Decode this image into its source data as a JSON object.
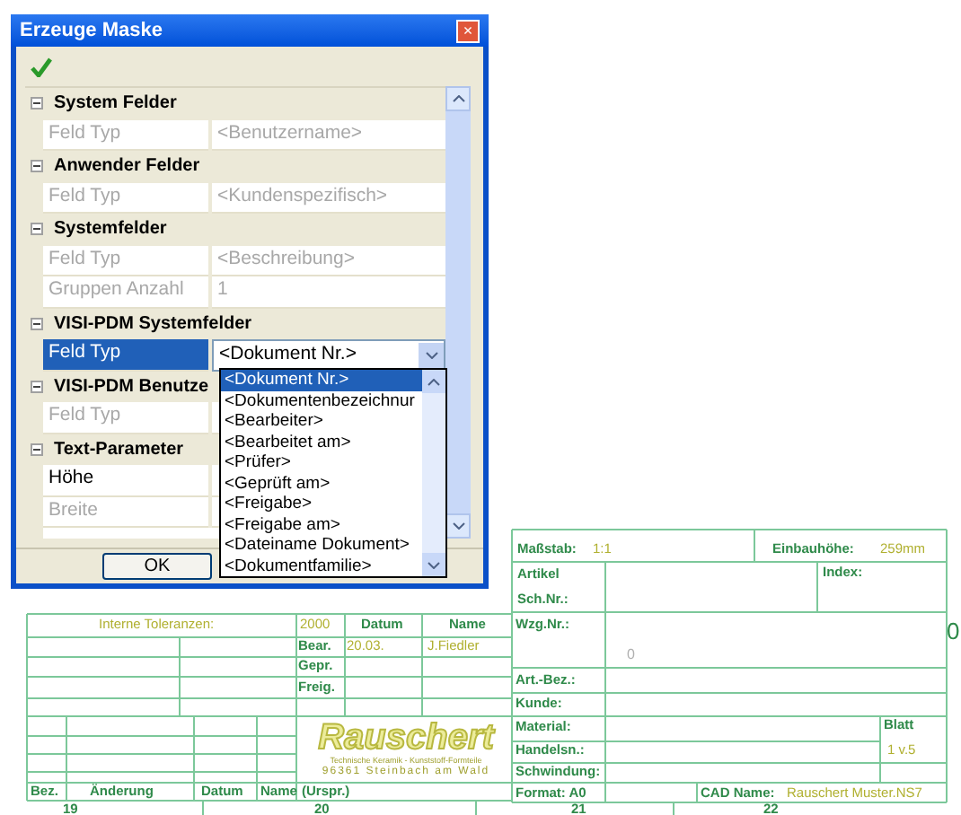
{
  "window": {
    "title": "Erzeuge Maske",
    "close": "×"
  },
  "sections": [
    {
      "title": "System Felder",
      "expanded": true,
      "rows": [
        {
          "label": "Feld Typ",
          "value": "<Benutzername>",
          "disabled": true,
          "selected": false
        }
      ]
    },
    {
      "title": "Anwender Felder",
      "expanded": true,
      "rows": [
        {
          "label": "Feld Typ",
          "value": "<Kundenspezifisch>",
          "disabled": true,
          "selected": false
        }
      ]
    },
    {
      "title": "Systemfelder",
      "expanded": true,
      "rows": [
        {
          "label": "Feld Typ",
          "value": "<Beschreibung>",
          "disabled": true,
          "selected": false
        },
        {
          "label": "Gruppen Anzahl",
          "value": "1",
          "disabled": true,
          "selected": false
        }
      ]
    },
    {
      "title": "VISI-PDM Systemfelder",
      "expanded": true,
      "rows": [
        {
          "label": "Feld Typ",
          "value": "<Dokument Nr.>",
          "disabled": false,
          "selected": true,
          "kind": "combo"
        }
      ]
    },
    {
      "title": "VISI-PDM Benutze",
      "expanded": true,
      "rows": [
        {
          "label": "Feld Typ",
          "disabled": true,
          "selected": false
        }
      ]
    },
    {
      "title": "Text-Parameter",
      "expanded": true,
      "rows": [
        {
          "label": "Höhe",
          "disabled": false,
          "selected": false
        },
        {
          "label": "Breite",
          "disabled": true,
          "selected": false
        }
      ]
    }
  ],
  "dropdown": {
    "items": [
      {
        "label": "<Dokument Nr.>",
        "selected": true
      },
      {
        "label": "<Dokumentenbezeichnur",
        "selected": false
      },
      {
        "label": "<Bearbeiter>",
        "selected": false
      },
      {
        "label": "<Bearbeitet am>",
        "selected": false
      },
      {
        "label": "<Prüfer>",
        "selected": false
      },
      {
        "label": "<Geprüft am>",
        "selected": false
      },
      {
        "label": "<Freigabe>",
        "selected": false
      },
      {
        "label": "<Freigabe am>",
        "selected": false
      },
      {
        "label": "<Dateiname Dokument>",
        "selected": false
      },
      {
        "label": "<Dokumentfamilie>",
        "selected": false
      }
    ]
  },
  "buttons": [
    {
      "label": "OK"
    }
  ],
  "drawing": {
    "texts": [
      {
        "text": "Interne Toleranzen:",
        "kind": "value"
      },
      {
        "text": "2000",
        "kind": "value"
      },
      {
        "text": "Datum",
        "kind": "label"
      },
      {
        "text": "Name",
        "kind": "label"
      },
      {
        "text": "Bear.",
        "kind": "label"
      },
      {
        "text": "20.03.",
        "kind": "value"
      },
      {
        "text": "J.Fiedler",
        "kind": "value"
      },
      {
        "text": "Gepr.",
        "kind": "label"
      },
      {
        "text": "Freig.",
        "kind": "label"
      },
      {
        "text": "Bez.",
        "kind": "label"
      },
      {
        "text": "Änderung",
        "kind": "label"
      },
      {
        "text": "Datum",
        "kind": "label"
      },
      {
        "text": "Name",
        "kind": "label"
      },
      {
        "text": "(Urspr.)",
        "kind": "label"
      },
      {
        "text": "Maßstab:",
        "kind": "label"
      },
      {
        "text": "1:1",
        "kind": "value"
      },
      {
        "text": "Einbauhöhe:",
        "kind": "label"
      },
      {
        "text": "259mm",
        "kind": "value"
      },
      {
        "text": "Artikel",
        "kind": "label"
      },
      {
        "text": "Sch.Nr.:",
        "kind": "label"
      },
      {
        "text": "Index:",
        "kind": "label"
      },
      {
        "text": "Wzg.Nr.:",
        "kind": "label"
      },
      {
        "text": "0",
        "kind": "faint"
      },
      {
        "text": "Art.-Bez.:",
        "kind": "label"
      },
      {
        "text": "Kunde:",
        "kind": "label"
      },
      {
        "text": "Material:",
        "kind": "label"
      },
      {
        "text": "Blatt",
        "kind": "label"
      },
      {
        "text": "Handelsn.:",
        "kind": "label"
      },
      {
        "text": "1 v.5",
        "kind": "value"
      },
      {
        "text": "Schwindung:",
        "kind": "label"
      },
      {
        "text": "Format: A0",
        "kind": "label"
      },
      {
        "text": "CAD Name:",
        "kind": "label"
      },
      {
        "text": "Rauschert Muster.NS7",
        "kind": "value"
      },
      {
        "text": "19",
        "kind": "label"
      },
      {
        "text": "20",
        "kind": "label"
      },
      {
        "text": "21",
        "kind": "label"
      },
      {
        "text": "22",
        "kind": "label"
      },
      {
        "text": "0",
        "kind": "big"
      }
    ],
    "logo": {
      "name": "Rauschert",
      "line_1": "Technische Keramik - Kunststoff-Formteile",
      "line_2": "96361 Steinbach am Wald"
    }
  }
}
